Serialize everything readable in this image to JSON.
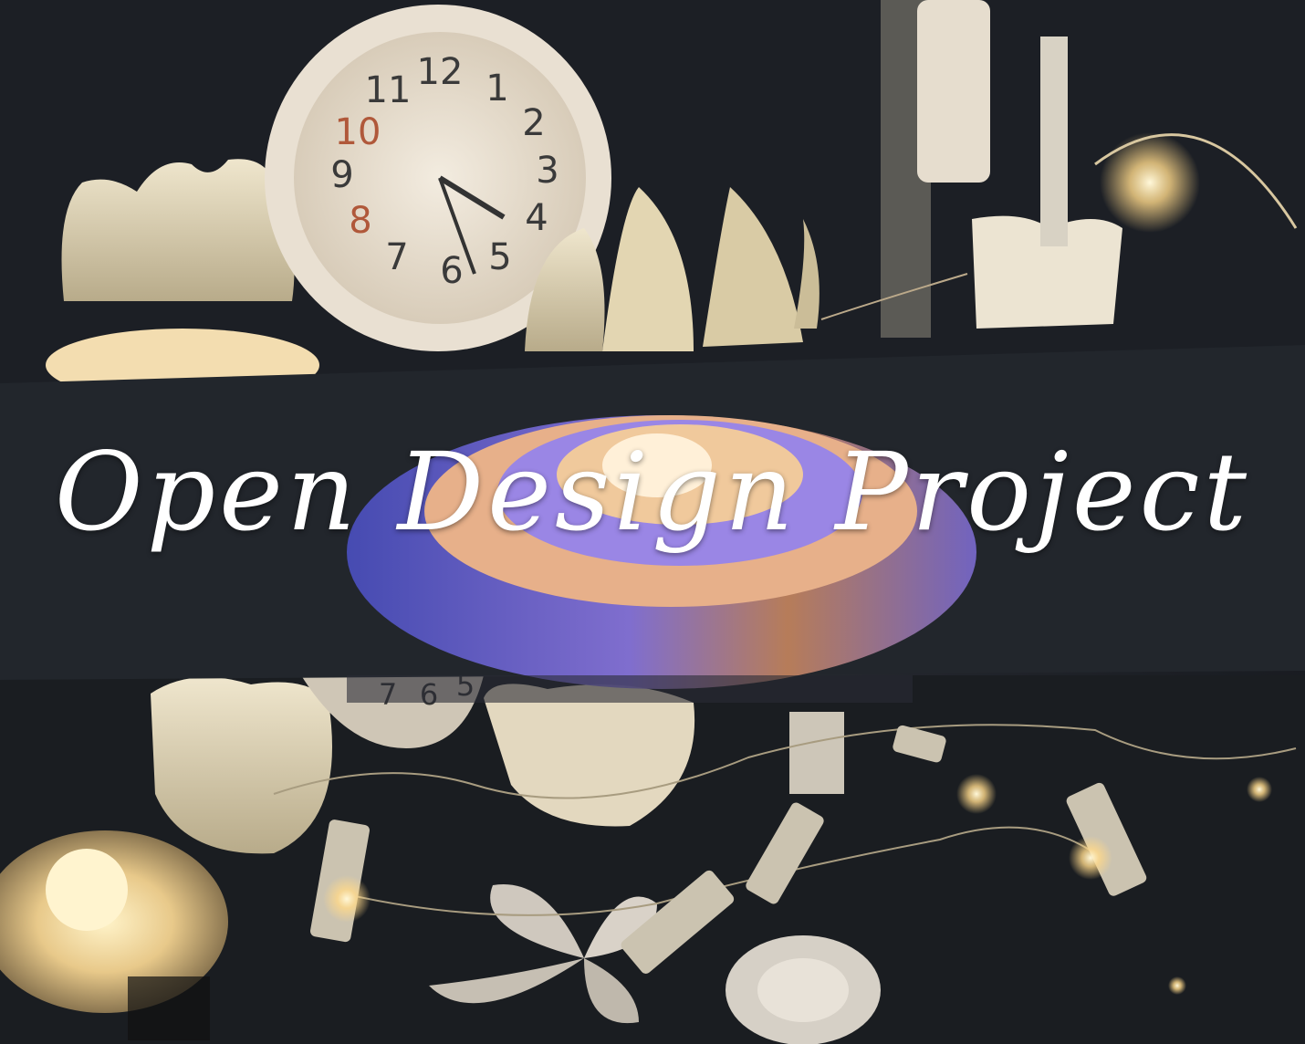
{
  "title": "Open Design Project",
  "clock": {
    "numerals": [
      "12",
      "1",
      "2",
      "3",
      "4",
      "5",
      "6",
      "7",
      "8",
      "9",
      "10",
      "11"
    ],
    "lower_numerals": [
      "7",
      "6",
      "5"
    ]
  },
  "colors": {
    "background": "#1b1e24",
    "band": "#22262c",
    "warm_light": "#f4dba0",
    "paper": "#ece4cf",
    "violet_glow": "#7c6fd6",
    "title_text": "#ffffff"
  }
}
